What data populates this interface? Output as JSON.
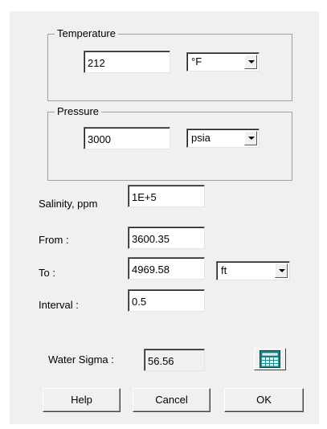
{
  "temperature": {
    "legend": "Temperature",
    "value": "212",
    "unit": "°F"
  },
  "pressure": {
    "legend": "Pressure",
    "value": "3000",
    "unit": "psia"
  },
  "salinity": {
    "label": "Salinity, ppm",
    "value": "1E+5"
  },
  "from": {
    "label": "From :",
    "value": "3600.35"
  },
  "to": {
    "label": "To :",
    "value": "4969.58",
    "unit": "ft"
  },
  "interval": {
    "label": "Interval :",
    "value": "0.5"
  },
  "water_sigma": {
    "label": "Water Sigma :",
    "value": "56.56",
    "calc_icon": "calculator-icon"
  },
  "buttons": {
    "help": "Help",
    "cancel": "Cancel",
    "ok": "OK"
  },
  "colors": {
    "dialog_bg": "#f0f0f0",
    "calc_icon_teal": "#1a8c8c"
  }
}
